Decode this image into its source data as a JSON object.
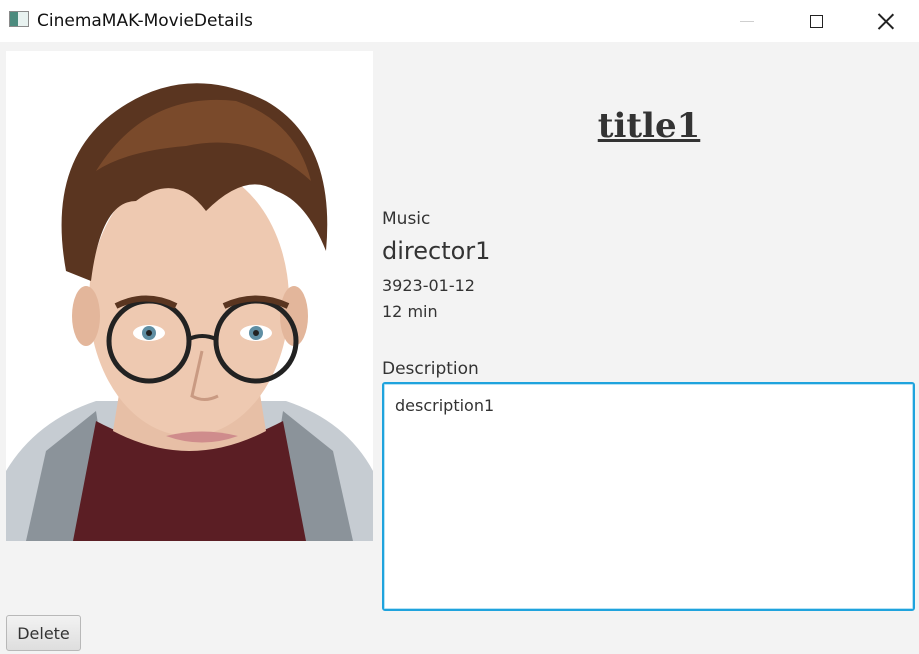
{
  "window": {
    "title": "CinemaMAK-MovieDetails",
    "app_icon": "app-icon",
    "controls": {
      "minimize_icon": "minimize-icon",
      "maximize_icon": "maximize-icon",
      "close_icon": "close-icon"
    }
  },
  "movie": {
    "title": "title1",
    "genre": "Music",
    "director": "director1",
    "release_date": "3923-01-12",
    "duration": "12 min",
    "description_label": "Description",
    "description": "description1",
    "poster_icon": "poster-image"
  },
  "actions": {
    "delete_label": "Delete"
  },
  "colors": {
    "focus_border": "#1fa3dd",
    "background": "#f3f3f3",
    "text": "#333333"
  }
}
